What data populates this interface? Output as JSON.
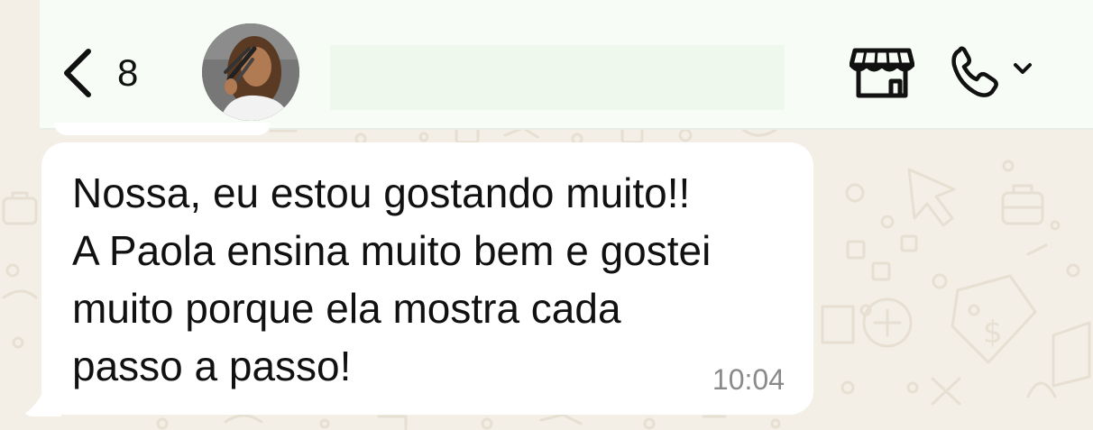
{
  "header": {
    "back_count": "8",
    "back_icon": "chevron-left-icon",
    "store_icon": "storefront-icon",
    "call_icon": "phone-icon",
    "call_menu_icon": "chevron-down-icon",
    "background_color": "#f7fcf6"
  },
  "message": {
    "lines": [
      "Nossa, eu estou gostando muito!!",
      "A Paola ensina muito bem e gostei",
      "muito porque ela mostra cada",
      "passo a passo!"
    ],
    "time": "10:04",
    "bubble_color": "#ffffff"
  },
  "chat": {
    "wallpaper_color": "#f3efe7",
    "doodle_color": "#e7e0d3"
  }
}
